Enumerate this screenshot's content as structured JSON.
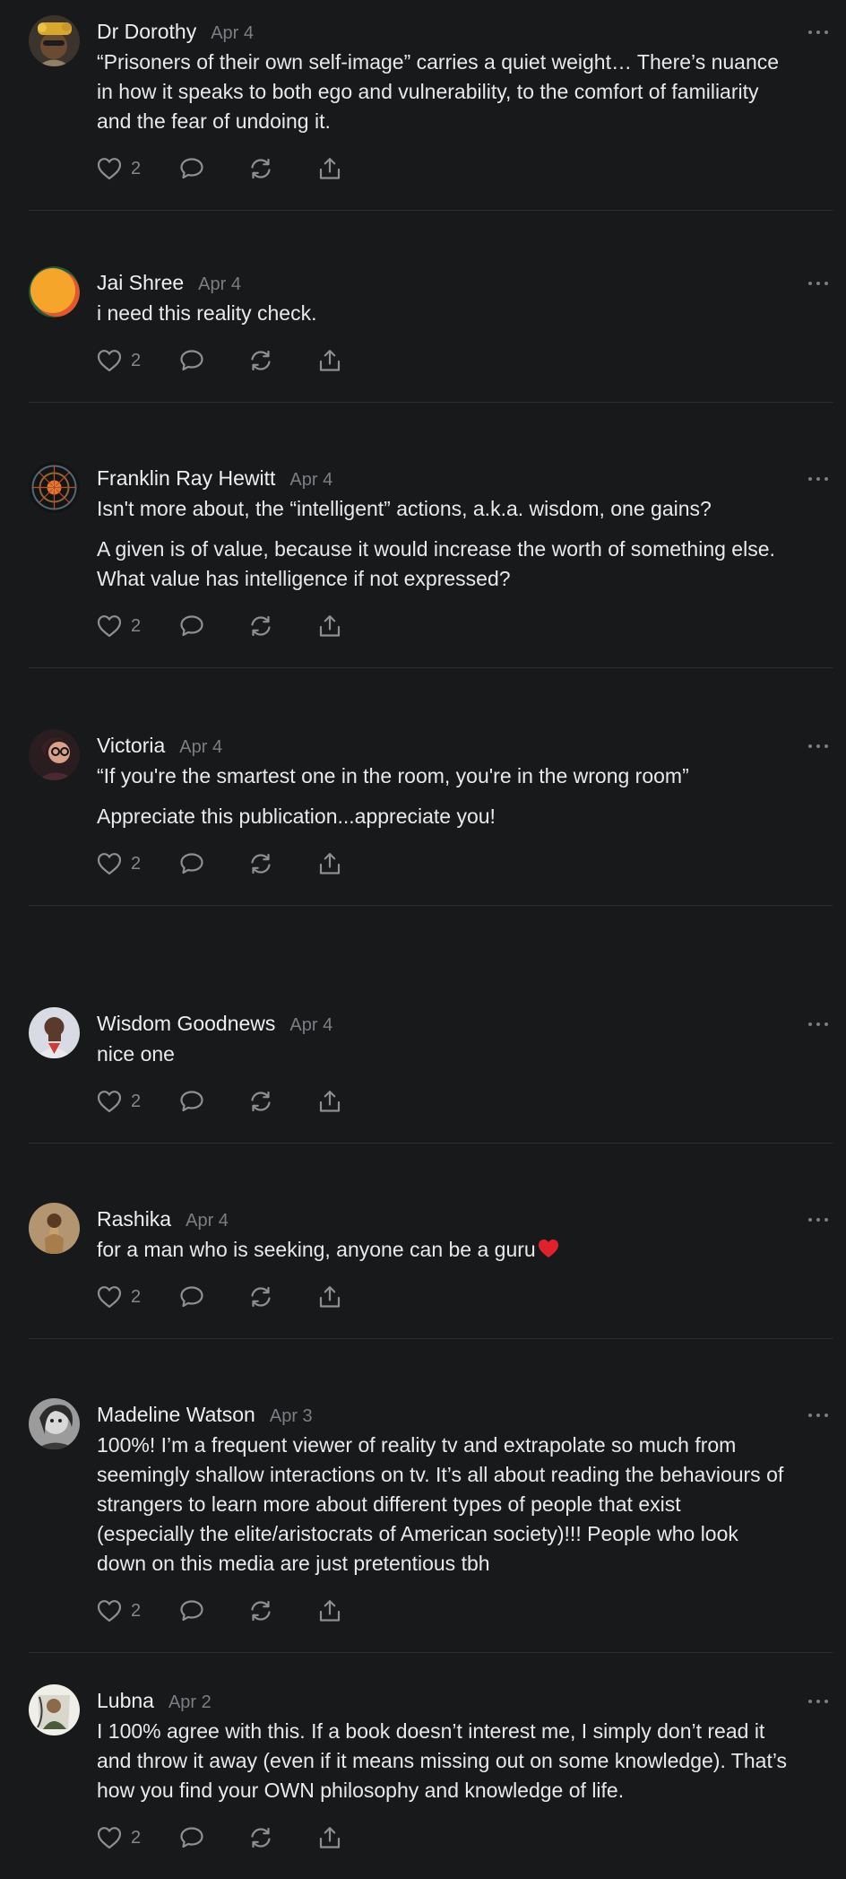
{
  "colors": {
    "background": "#18191b",
    "text": "#e9e9e9",
    "muted": "#7d7e82",
    "divider": "#2c2d30",
    "heart_emoji": "#e0212c"
  },
  "icons": {
    "like": "heart-icon",
    "reply": "speech-bubble-icon",
    "restack": "refresh-cycle-icon",
    "share": "share-upload-icon",
    "more": "ellipsis-icon"
  },
  "comments": [
    {
      "name": "Dr Dorothy",
      "date": "Apr 4",
      "paragraphs": [
        "“Prisoners of their own self-image” carries a quiet weight… There’s nuance in how it speaks to both ego and vulnerability, to the comfort of familiarity and the fear of undoing it."
      ],
      "likes": "2"
    },
    {
      "name": "Jai Shree",
      "date": "Apr 4",
      "paragraphs": [
        "i need this reality check."
      ],
      "likes": "2"
    },
    {
      "name": "Franklin Ray Hewitt",
      "date": "Apr 4",
      "paragraphs": [
        "Isn't more about, the “intelligent” actions, a.k.a. wisdom, one gains?",
        "A given is of value, because it would increase the worth of something else. What value has intelligence if not expressed?"
      ],
      "likes": "2"
    },
    {
      "name": "Victoria",
      "date": "Apr 4",
      "paragraphs": [
        "“If you're the smartest one in the room, you're in the wrong room”",
        "Appreciate this publication...appreciate you!"
      ],
      "likes": "2"
    },
    {
      "name": "Wisdom Goodnews",
      "date": "Apr 4",
      "paragraphs": [
        "nice one"
      ],
      "likes": "2"
    },
    {
      "name": "Rashika",
      "date": "Apr 4",
      "paragraphs": [
        "for a man who is seeking, anyone can be a guru"
      ],
      "likes": "2"
    },
    {
      "name": "Madeline Watson",
      "date": "Apr 3",
      "paragraphs": [
        "100%! I’m a frequent viewer of reality tv and extrapolate so much from seemingly shallow interactions on tv. It’s all about reading the behaviours of strangers to learn more about different types of people that exist (especially the elite/aristocrats of American society)!!! People who look down on this media are just pretentious tbh"
      ],
      "likes": "2"
    },
    {
      "name": "Lubna",
      "date": "Apr 2",
      "paragraphs": [
        "I 100% agree with this. If a book doesn’t interest me, I simply don’t read it and throw it away (even if it means missing out on some knowledge). That’s how you find your OWN philosophy and knowledge of life."
      ],
      "likes": "2"
    }
  ]
}
